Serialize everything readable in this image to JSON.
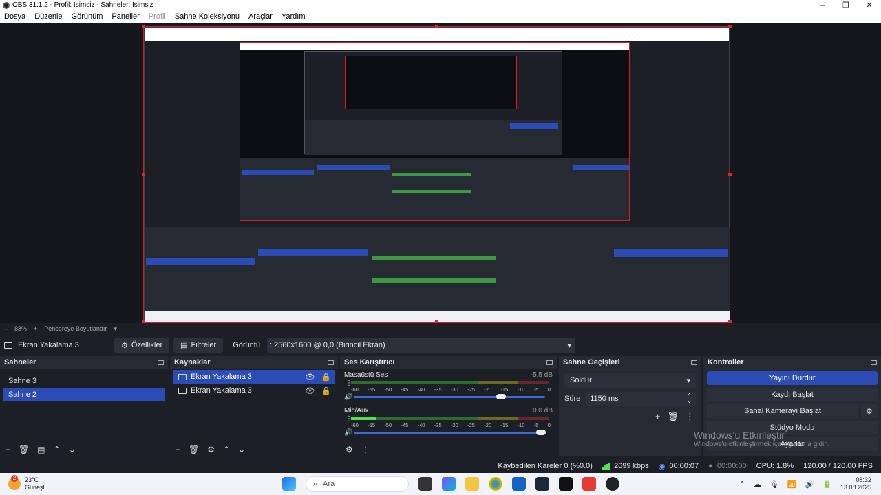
{
  "window": {
    "title": "OBS 31.1.2 - Profil: İsimsiz - Sahneler: İsimsiz",
    "controls": [
      "–",
      "❐",
      "✕"
    ]
  },
  "menu": {
    "items": [
      {
        "label": "Dosya",
        "enabled": true
      },
      {
        "label": "Düzenle",
        "enabled": true
      },
      {
        "label": "Görünüm",
        "enabled": true
      },
      {
        "label": "Paneller",
        "enabled": true
      },
      {
        "label": "Profil",
        "enabled": false
      },
      {
        "label": "Sahne Koleksiyonu",
        "enabled": true
      },
      {
        "label": "Araçlar",
        "enabled": true
      },
      {
        "label": "Yardım",
        "enabled": true
      }
    ]
  },
  "zoom": {
    "minus": "–",
    "value": "88%",
    "plus": "+",
    "mode": "Pencereye Boyutlandır"
  },
  "source_toolbar": {
    "source_name": "Ekran Yakalama 3",
    "properties_label": "Özellikler",
    "filters_label": "Filtreler",
    "display_label": "Görüntü",
    "display_value": ": 2560x1600 @ 0,0 (Birincil Ekran)"
  },
  "scenes": {
    "title": "Sahneler",
    "items": [
      {
        "label": "Sahne 3",
        "selected": false
      },
      {
        "label": "Sahne 2",
        "selected": true
      }
    ]
  },
  "sources": {
    "title": "Kaynaklar",
    "items": [
      {
        "label": "Ekran Yakalama 3",
        "selected": true
      },
      {
        "label": "Ekran Yakalama 3",
        "selected": false
      }
    ]
  },
  "mixer": {
    "title": "Ses Karıştırıcı",
    "scale": [
      "-60",
      "-55",
      "-50",
      "-45",
      "-40",
      "-35",
      "-30",
      "-25",
      "-20",
      "-15",
      "-10",
      "-5",
      "0"
    ],
    "channels": [
      {
        "name": "Masaüstü Ses",
        "db": "-5.5 dB",
        "level_fraction": 0.0,
        "volume_fraction": 0.77
      },
      {
        "name": "Mic/Aux",
        "db": "0.0 dB",
        "level_fraction": 0.13,
        "volume_fraction": 0.98
      }
    ]
  },
  "transitions": {
    "title": "Sahne Geçişleri",
    "selected": "Soldur",
    "duration_label": "Süre",
    "duration_value": "1150 ms"
  },
  "controls": {
    "title": "Kontroller",
    "buttons": [
      "Yayını Durdur",
      "Kaydı Başlat",
      "Sanal Kamerayı Başlat",
      "Stüdyo Modu",
      "Ayarlar"
    ]
  },
  "status": {
    "dropped": "Kaybedilen Kareler 0 (%0.0)",
    "bitrate": "2699 kbps",
    "stream_time": "00:00:07",
    "record_time": "00:00:00",
    "cpu": "CPU: 1.8%",
    "fps": "120.00 / 120.00 FPS"
  },
  "watermark": {
    "line1": "Windows'u Etkinleştir",
    "line2": "Windows'u etkinleştirmek için Ayarlar'a gidin."
  },
  "taskbar": {
    "weather_temp": "23°C",
    "weather_text": "Güneşli",
    "weather_badge": "2",
    "search_placeholder": "Ara",
    "time": "08:32",
    "date": "13.08.2025"
  },
  "colors": {
    "accent": "#2b4bb5",
    "selection_border": "#d81b28",
    "meter_green": "#4fe24f"
  }
}
